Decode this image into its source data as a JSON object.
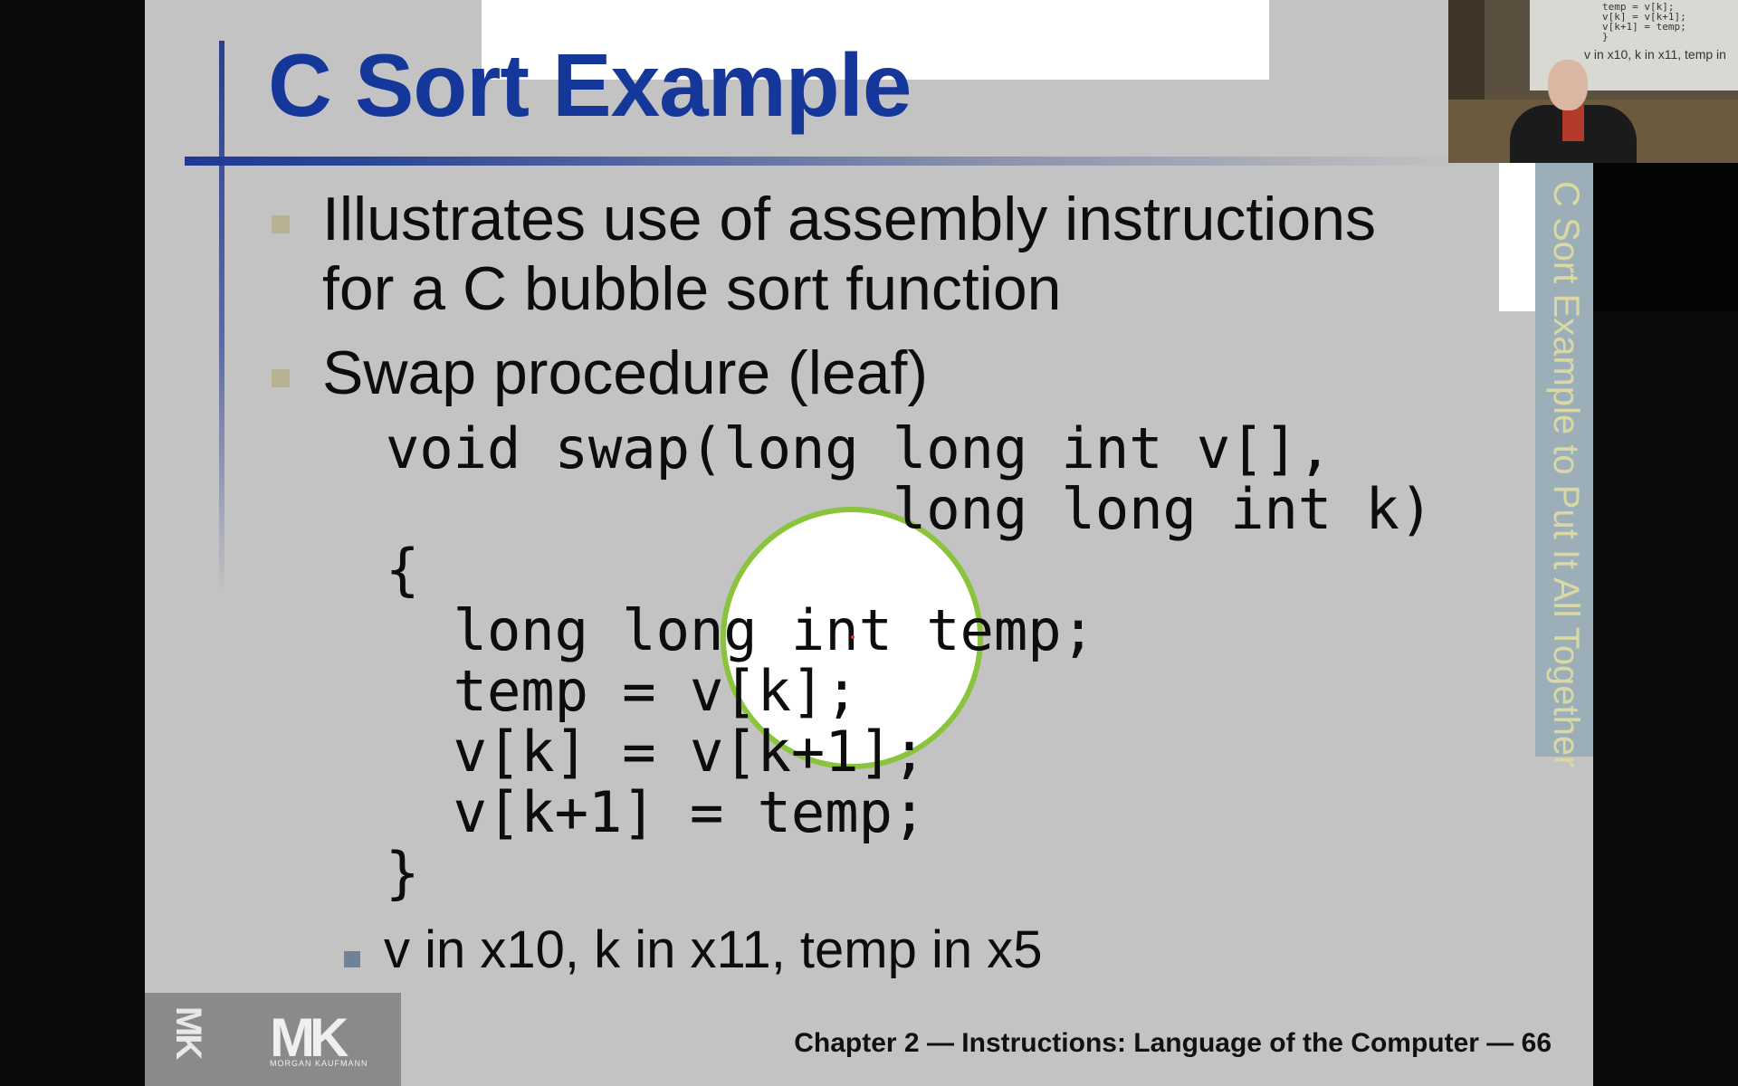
{
  "slide": {
    "title": "C Sort Example",
    "bullets": [
      {
        "line1": "Illustrates use of assembly instructions",
        "line2": "for a C bubble sort function"
      },
      {
        "line1": "Swap procedure (leaf)"
      }
    ],
    "code": "void swap(long long int v[],\n               long long int k)\n{\n  long long int temp;\n  temp = v[k];\n  v[k] = v[k+1];\n  v[k+1] = temp;\n}",
    "sub_bullet": "v in x10, k in x11, temp in x5",
    "footer": "Chapter 2 — Instructions: Language of the Computer — 66",
    "side_tab": "C Sort Example to Put It All Together",
    "logo": {
      "mark": "MK",
      "text": "MORGAN KAUFMANN"
    }
  },
  "webcam": {
    "screen_code": "temp = v[k];\nv[k] = v[k+1];\nv[k+1] = temp;\n}",
    "screen_caption": "v in x10, k in x11, temp in"
  },
  "colors": {
    "title": "#16379a",
    "background": "#c3c3c3",
    "spotlight_ring": "#8ac43d",
    "side_tab": "#9cafb9"
  },
  "icons": [
    "bullet-square-icon",
    "spotlight-icon",
    "logo-icon"
  ]
}
